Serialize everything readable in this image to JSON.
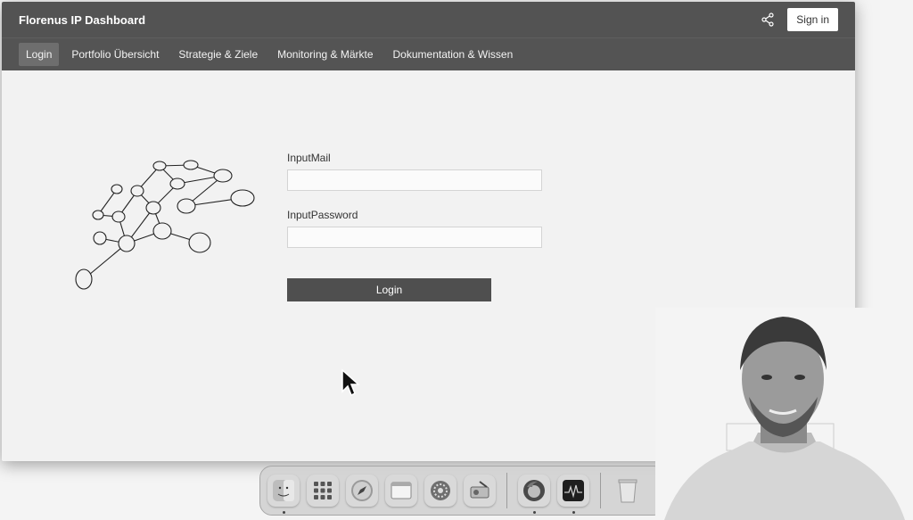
{
  "window": {
    "title": "Florenus IP Dashboard",
    "signin_label": "Sign in"
  },
  "nav": {
    "tabs": [
      {
        "label": "Login",
        "active": true
      },
      {
        "label": "Portfolio Übersicht",
        "active": false
      },
      {
        "label": "Strategie & Ziele",
        "active": false
      },
      {
        "label": "Monitoring & Märkte",
        "active": false
      },
      {
        "label": "Dokumentation & Wissen",
        "active": false
      }
    ]
  },
  "form": {
    "mail_label": "InputMail",
    "mail_value": "",
    "password_label": "InputPassword",
    "password_value": "",
    "login_button": "Login"
  },
  "icons": {
    "share": "share-icon",
    "network": "network-graph-icon",
    "cursor": "mouse-pointer-icon"
  },
  "dock": {
    "items": [
      {
        "name": "finder-icon",
        "running": true
      },
      {
        "name": "launchpad-icon",
        "running": false
      },
      {
        "name": "safari-icon",
        "running": false
      },
      {
        "name": "notes-icon",
        "running": false
      },
      {
        "name": "system-settings-icon",
        "running": false
      },
      {
        "name": "disk-utility-icon",
        "running": false
      },
      {
        "name": "firefox-icon",
        "running": true
      },
      {
        "name": "activity-monitor-icon",
        "running": true
      },
      {
        "name": "trash-icon",
        "running": false
      }
    ]
  },
  "colors": {
    "titlebar": "#535353",
    "navbar": "#545454",
    "login_button": "#4f4f4f"
  }
}
